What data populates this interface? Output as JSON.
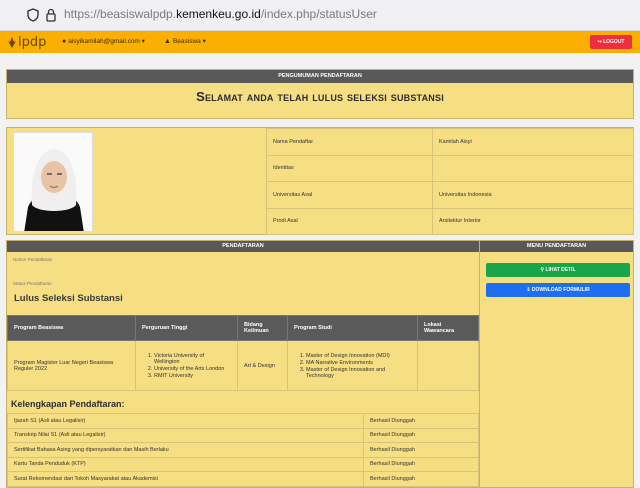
{
  "browser": {
    "url_prefix": "https://beasiswalpdp.",
    "url_domain": "kemenkeu.go.id",
    "url_path": "/index.php/statusUser"
  },
  "navbar": {
    "logo_text": "lpdp",
    "user_email": "aisyikamilah@gmail.com",
    "menu_beasiswa": "Beasiswa",
    "logout_label": "LOGOUT",
    "colors": {
      "bar": "#fbaf00",
      "logout": "#ef2d3e"
    }
  },
  "announcement": {
    "header": "PENGUMUMAN PENDAFTARAN",
    "title": "Selamat anda telah lulus seleksi substansi"
  },
  "profile": {
    "rows": [
      {
        "label": "Nama Pendaftar",
        "value": "Kamilah Aisyi"
      },
      {
        "label": "Identitas",
        "value": ""
      },
      {
        "label": "Universitas Asal",
        "value": "Universitas Indonesia"
      },
      {
        "label": "Prodi Asal",
        "value": "Arsitektur Interior"
      }
    ]
  },
  "registration": {
    "header": "PENDAFTARAN",
    "nomor_label": "Nomor Pendaftaran",
    "status_label": "Status Pendaftaran",
    "status_value": "Lulus Seleksi Substansi",
    "columns": [
      "Program Beasiswa",
      "Perguruan Tinggi",
      "Bidang Keilmuan",
      "Program Studi",
      "Lokasi Wawancara"
    ],
    "row": {
      "program": "Program Magister Luar Negeri Beasiswa Reguler 2022",
      "universities": [
        "Victoria University of Wellington",
        "University of the Arts London",
        "RMIT University"
      ],
      "bidang": "Art & Design",
      "programs": [
        "Master of Design Innovation (MDI)",
        "MA Narrative Environments",
        "Master of Design Innovation and Technology"
      ],
      "lokasi": ""
    },
    "kelengkapan_title": "Kelengkapan Pendaftaran:",
    "documents": [
      {
        "name": "Ijazah S1 (Asli atau Legalisir)",
        "status": "Berhasil Diunggah"
      },
      {
        "name": "Transkrip Nilai S1 (Asli atau Legalisir)",
        "status": "Berhasil Diunggah"
      },
      {
        "name": "Sertifikat Bahasa Asing yang dipersyaratkan dan Masih Berlaku",
        "status": "Berhasil Diunggah"
      },
      {
        "name": "Kartu Tanda Penduduk (KTP)",
        "status": "Berhasil Diunggah"
      },
      {
        "name": "Surat Rekomendasi dari Tokoh Masyarakat atau Akademisi",
        "status": "Berhasil Diunggah"
      }
    ]
  },
  "menu": {
    "header": "MENU PENDAFTARAN",
    "detail_label": "LIHAT DETIL",
    "download_label": "DOWNLOAD FORMULIR",
    "colors": {
      "detail": "#19a548",
      "download": "#1e6ef2"
    }
  }
}
